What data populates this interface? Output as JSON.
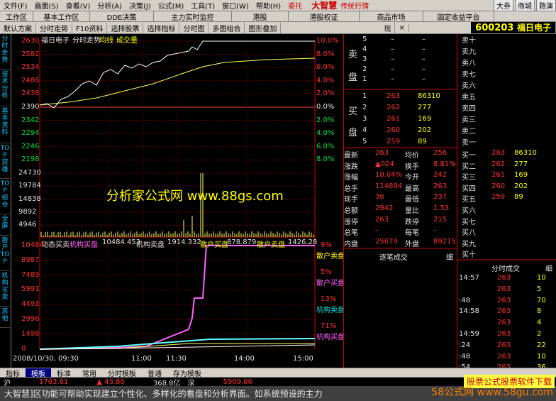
{
  "menu": {
    "items": [
      "文件(F)",
      "画面(S)",
      "查看(V)",
      "分析(A)",
      "决策(J)",
      "公式(M)",
      "工具(T)",
      "窗口(W)",
      "帮助(H)"
    ],
    "notice": "委托",
    "brand": "大智慧",
    "slogan": "传统行情",
    "right_buttons": [
      "大券",
      "商城",
      "路演"
    ]
  },
  "nav": {
    "items": [
      "工作区",
      "基本工作区",
      "DDE决策",
      "主力实时监控",
      "港股",
      "港股权证",
      "商品市场",
      "固定收益平台"
    ]
  },
  "toolbar": {
    "items": [
      "默认方案",
      "分时走势",
      "F10资料",
      "选择股票",
      "选择指标",
      "分时图",
      "多图组合",
      "图形叠加"
    ],
    "btn_present": "现",
    "code": "600203",
    "name": "福日电子"
  },
  "sidetabs": [
    "分时走势",
    "技术分析",
    "基本资料",
    "TOP双雄",
    "TOP综合",
    "全屏",
    "散户TOP",
    "机构买卖",
    "其他"
  ],
  "chart_header": {
    "name": "福日电子",
    "label": "分时走势",
    "line1": "均线",
    "line2": "成交量"
  },
  "price_axis": {
    "left": [
      "2630",
      "2582",
      "2534",
      "2486",
      "2438",
      "2390",
      "2342",
      "2294",
      "2246",
      "2198"
    ],
    "right": [
      "10.0%",
      "8.0%",
      "6.0%",
      "4.0%",
      "2.0%",
      "0.0%",
      "2.0%",
      "4.0%",
      "6.0%",
      "8.0%"
    ]
  },
  "vol_axis": [
    "24730",
    "19784",
    "14838",
    "9892",
    "4946"
  ],
  "flow_header": {
    "title": "动态买卖",
    "s1": "机构买盘",
    "v1": "10484.453",
    "s2": "机构卖盘",
    "v2": "1914.332",
    "s3": "散户买盘",
    "v3": "878.879",
    "s4": "散户卖盘",
    "v4": "1426.28"
  },
  "flow_axis": [
    "10484",
    "8987",
    "7489",
    "5991",
    "4493",
    "2996",
    "1498",
    "0"
  ],
  "flow_pct": [
    {
      "p": "9%",
      "l": "散户卖盘"
    },
    {
      "p": "5%",
      "l": "散户买盘"
    },
    {
      "p": "13%",
      "l": "机构卖盘"
    },
    {
      "p": "71%",
      "l": "机构买盘"
    }
  ],
  "time_axis": [
    "2008/10/30, 09:30",
    "11:00",
    "11:30",
    "14:00",
    "15:00"
  ],
  "sell": [
    [
      "5",
      "–",
      "–"
    ],
    [
      "4",
      "–",
      "–"
    ],
    [
      "3",
      "–",
      "–"
    ],
    [
      "2",
      "–",
      "–"
    ],
    [
      "1",
      "–",
      "–"
    ]
  ],
  "sell_labels": [
    "卖",
    "盘"
  ],
  "buy_labels": [
    "买",
    "盘"
  ],
  "buy": [
    [
      "1",
      "263",
      "86310"
    ],
    [
      "2",
      "262",
      "277"
    ],
    [
      "3",
      "261",
      "169"
    ],
    [
      "4",
      "260",
      "202"
    ],
    [
      "5",
      "259",
      "89"
    ]
  ],
  "stats": [
    [
      "最新",
      "263",
      "均价",
      "256"
    ],
    [
      "涨跌",
      "▲024",
      "换手",
      "8.81%"
    ],
    [
      "涨幅",
      "10.04%",
      "今开",
      "242"
    ],
    [
      "总手",
      "114894",
      "最高",
      "263"
    ],
    [
      "现手",
      "36",
      "最低",
      "237"
    ],
    [
      "总额",
      "2942",
      "量比",
      "1.53"
    ],
    [
      "涨停",
      "263",
      "跌停",
      "215"
    ],
    [
      "总笔",
      "–",
      "每笔",
      "–"
    ],
    [
      "内盘",
      "25679",
      "外盘",
      "89215"
    ]
  ],
  "queue_sell": [
    "卖十",
    "卖九",
    "卖八",
    "卖七",
    "卖六",
    "卖五",
    "卖四",
    "卖三",
    "卖二",
    "卖一"
  ],
  "queue_buy": [
    [
      "买一",
      "263",
      "86310"
    ],
    [
      "买二",
      "262",
      "277"
    ],
    [
      "买三",
      "261",
      "169"
    ],
    [
      "买四",
      "260",
      "202"
    ],
    [
      "买五",
      "259",
      "89"
    ],
    [
      "买六",
      "",
      ""
    ],
    [
      "买七",
      "",
      ""
    ],
    [
      "买八",
      "",
      ""
    ],
    [
      "买九",
      "",
      ""
    ],
    [
      "买十",
      "",
      ""
    ]
  ],
  "deal_title": "逐笔成交",
  "deal_btn": "细",
  "ticks_title": "分时成交",
  "ticks_btn": "细",
  "ticks": [
    [
      "14:57",
      "263",
      "10"
    ],
    [
      "",
      "263",
      "5"
    ],
    [
      ":48",
      "263",
      "70"
    ],
    [
      "14:58",
      "263",
      "8"
    ],
    [
      "",
      "263",
      "4"
    ],
    [
      "14:59",
      "263",
      "2"
    ],
    [
      ":24",
      "263",
      "22"
    ],
    [
      ":48",
      "263",
      "10"
    ],
    [
      ":54",
      "263",
      "36"
    ]
  ],
  "bottom": [
    "指标",
    "模板",
    "标准",
    "常用",
    "分时模板",
    "普通",
    "存为模板"
  ],
  "status": {
    "sh": "沪",
    "sh_val": "1763.61",
    "sh_chg": "▲ 43.80",
    "sh_amt": "368.8亿",
    "sz": "深",
    "sz_val": "5909.66"
  },
  "ticker": "大智慧]区功能可帮助实现建立个性化、多样化的看盘和分析界面。如系统预设的主力",
  "watermark": "分析家公式网 www.88gs.com",
  "ad": "股票公式股票软件下载",
  "site": "58公式网 www.58gu.com"
}
